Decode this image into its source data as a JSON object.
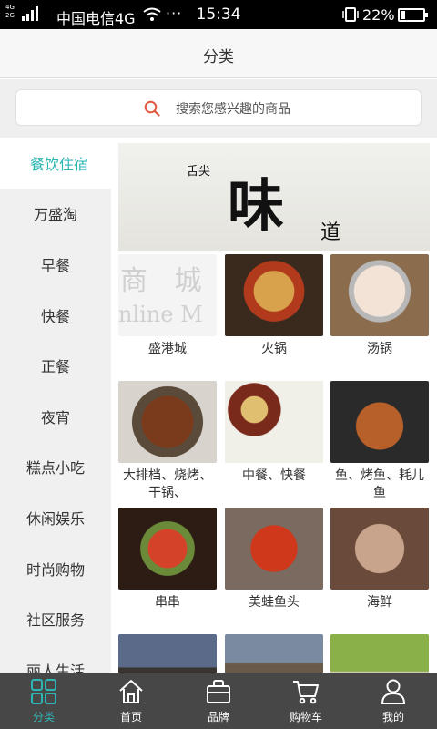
{
  "status_bar": {
    "network_top": "4G",
    "network_bottom": "2G",
    "carrier": "中国电信4G",
    "more": "···",
    "time": "15:34",
    "battery_percent_text": "22%",
    "battery_level": 0.22
  },
  "header": {
    "title": "分类"
  },
  "search": {
    "placeholder": "搜索您感兴趣的商品",
    "icon": "search-icon"
  },
  "sidebar": {
    "items": [
      {
        "label": "餐饮住宿",
        "active": true
      },
      {
        "label": "万盛淘"
      },
      {
        "label": "早餐"
      },
      {
        "label": "快餐"
      },
      {
        "label": "正餐"
      },
      {
        "label": "夜宵"
      },
      {
        "label": "糕点小吃"
      },
      {
        "label": "休闲娱乐"
      },
      {
        "label": "时尚购物"
      },
      {
        "label": "社区服务"
      },
      {
        "label": "丽人生活"
      }
    ]
  },
  "banner": {
    "small_text": "舌尖",
    "big_text": "味",
    "tail_text": "道"
  },
  "categories": [
    {
      "label": "盛港城",
      "image": "mall-store-image",
      "image_text_1": "商 城",
      "image_text_2": "nline M"
    },
    {
      "label": "火锅",
      "image": "hotpot-image"
    },
    {
      "label": "汤锅",
      "image": "soup-pot-image"
    },
    {
      "label": "大排档、烧烤、干锅、",
      "image": "food-stall-image"
    },
    {
      "label": "中餐、快餐",
      "image": "chinese-meal-image"
    },
    {
      "label": "鱼、烤鱼、耗儿鱼",
      "image": "grilled-fish-image"
    },
    {
      "label": "串串",
      "image": "skewers-image"
    },
    {
      "label": "美蛙鱼头",
      "image": "fish-head-image"
    },
    {
      "label": "海鲜",
      "image": "seafood-image"
    },
    {
      "label": "",
      "image": "hotel-building-image"
    },
    {
      "label": "",
      "image": "building-image"
    },
    {
      "label": "",
      "image": "garden-image"
    }
  ],
  "tabbar": {
    "tabs": [
      {
        "label": "分类",
        "icon": "category-grid-icon",
        "active": true
      },
      {
        "label": "首页",
        "icon": "home-icon"
      },
      {
        "label": "品牌",
        "icon": "brand-bag-icon"
      },
      {
        "label": "购物车",
        "icon": "cart-icon"
      },
      {
        "label": "我的",
        "icon": "user-icon"
      }
    ]
  },
  "colors": {
    "accent": "#2cb6b3",
    "tabbar_bg": "#474747",
    "sidebar_bg": "#f0f0f0"
  }
}
